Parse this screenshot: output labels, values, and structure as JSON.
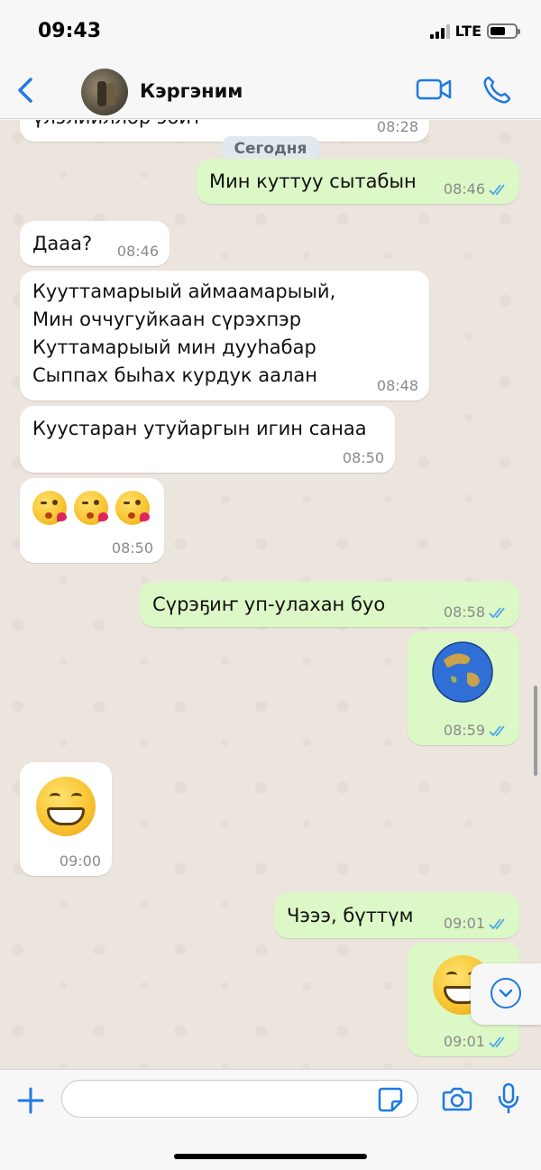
{
  "status_bar": {
    "time": "09:43",
    "network": "LTE",
    "battery_level": 0.6
  },
  "header": {
    "contact_name": "Кэргэним"
  },
  "chat": {
    "date_divider": "Сегодня",
    "messages": [
      {
        "direction": "in",
        "text": "үлэлиилләр эбит",
        "time": "08:28"
      },
      {
        "direction": "out",
        "text": "Мин куттуу сытабын",
        "time": "08:46",
        "read": true
      },
      {
        "direction": "in",
        "text": "Дааа?",
        "time": "08:46"
      },
      {
        "direction": "in",
        "lines": [
          "Кууттамарыый аймаамарыый,",
          "Мин оччугуйкаан сүрэхпэр",
          "Куттамарыый мин дууһабар",
          "Сыппах быһах курдук аалан"
        ],
        "time": "08:48"
      },
      {
        "direction": "in",
        "text": "Куустаран утуйаргын игин санаа",
        "time": "08:50"
      },
      {
        "direction": "in",
        "emoji": "face-blowing-a-kiss x3",
        "time": "08:50"
      },
      {
        "direction": "out",
        "text": "Сүрэҕиҥ уп-улахан буо",
        "time": "08:58",
        "read": true
      },
      {
        "direction": "out",
        "emoji": "globe-asia-australia",
        "time": "08:59",
        "read": true
      },
      {
        "direction": "in",
        "emoji": "beaming-face-with-smiling-eyes",
        "time": "09:00"
      },
      {
        "direction": "out",
        "text": "Чэээ, бүттүм",
        "time": "09:01",
        "read": true
      },
      {
        "direction": "out",
        "emoji": "beaming-face-with-smiling-eyes",
        "time": "09:01",
        "read": true
      }
    ]
  },
  "input": {
    "placeholder": ""
  },
  "colors": {
    "accent": "#1f7ae0",
    "outgoing_bubble": "#dcf8c6",
    "incoming_bubble": "#ffffff",
    "read_ticks": "#4fa5e6"
  }
}
